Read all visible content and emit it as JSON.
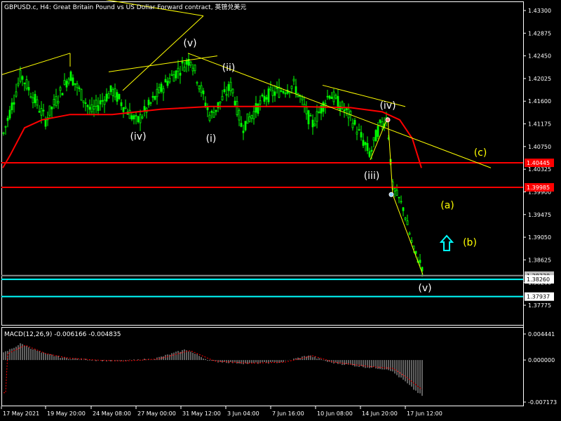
{
  "chart_data": [
    {
      "type": "line",
      "title": "GBPUSD.c, H4:  Great Britain Pound vs US Dollar Forward contract, 英镑兑美元",
      "yaxis_ticks": [
        "1.43300",
        "1.42875",
        "1.42450",
        "1.42025",
        "1.41600",
        "1.41175",
        "1.40750",
        "1.40325",
        "1.39900",
        "1.39475",
        "1.39050",
        "1.38625",
        "1.38200",
        "1.37775"
      ],
      "ylim": [
        1.3752,
        1.4345
      ],
      "xaxis_ticks": [
        "17 May 2021",
        "19 May 20:00",
        "24 May 08:00",
        "27 May 00:00",
        "31 May 12:00",
        "3 Jun 04:00",
        "7 Jun 16:00",
        "10 Jun 08:00",
        "14 Jun 20:00",
        "17 Jun 12:00"
      ],
      "price_labels": [
        {
          "text": "1.40445",
          "value": 1.40445,
          "bg": "#ff0000",
          "fg": "#ffffff"
        },
        {
          "text": "1.39985",
          "value": 1.39985,
          "bg": "#ff0000",
          "fg": "#ffffff"
        },
        {
          "text": "1.38330",
          "value": 1.3833,
          "bg": "#c0c0c0",
          "fg": "#000000"
        },
        {
          "text": "1.38260",
          "value": 1.3826,
          "bg": "#ffffff",
          "fg": "#000000"
        },
        {
          "text": "1.37937",
          "value": 1.37937,
          "bg": "#ffffff",
          "fg": "#000000"
        }
      ],
      "horizontal_lines": [
        {
          "value": 1.40445,
          "color": "#ff0000"
        },
        {
          "value": 1.39985,
          "color": "#ff0000"
        },
        {
          "value": 1.3826,
          "color": "#00ffff"
        },
        {
          "value": 1.37937,
          "color": "#00ffff"
        },
        {
          "value": 1.3833,
          "color": "#8a8a8a"
        }
      ],
      "wave_labels": [
        {
          "text": "(v)",
          "color": "#ffffff"
        },
        {
          "text": "(ii)",
          "color": "#ffffff"
        },
        {
          "text": "(iv)",
          "color": "#ffffff"
        },
        {
          "text": "(i)",
          "color": "#ffffff"
        },
        {
          "text": "(iv)",
          "color": "#ffffff"
        },
        {
          "text": "(iii)",
          "color": "#ffffff"
        },
        {
          "text": "(v)",
          "color": "#ffffff"
        },
        {
          "text": "(c)",
          "color": "#ffff00"
        },
        {
          "text": "(a)",
          "color": "#ffff00"
        },
        {
          "text": "(b)",
          "color": "#ffff00"
        }
      ],
      "colors": {
        "background": "#000000",
        "candles": "#00ff00",
        "moving_average": "#ff0000",
        "trendlines": "#ffff00",
        "support": "#00ffff",
        "arrow": "#00ffff",
        "axis": "#ffffff"
      }
    },
    {
      "type": "bar",
      "title": "MACD(12,26,9) -0.006166 -0.004835",
      "yaxis_ticks": [
        "0.004441",
        "0.000000",
        "-0.007173"
      ],
      "ylim": [
        -0.007173,
        0.004441
      ],
      "colors": {
        "histogram": "#c0c0c0",
        "signal": "#ff0000"
      }
    }
  ]
}
